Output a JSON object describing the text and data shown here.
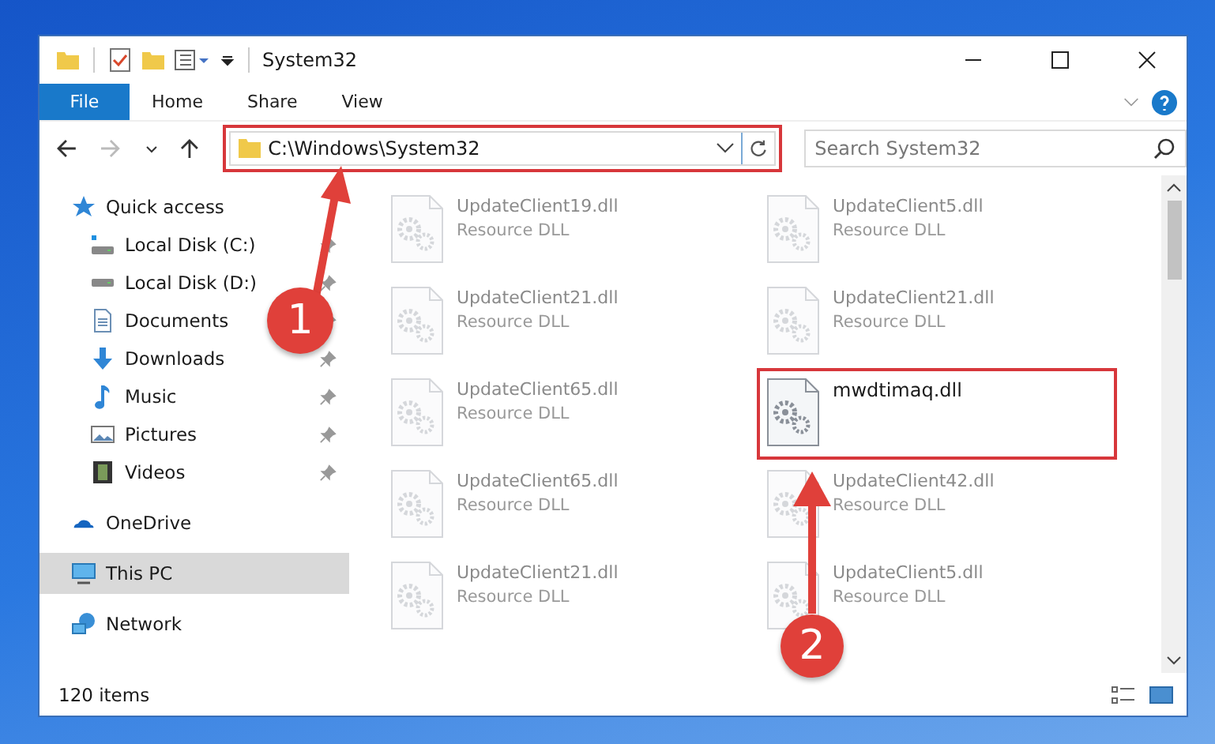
{
  "window": {
    "title": "System32"
  },
  "ribbon_tabs": [
    {
      "label": "File",
      "kind": "file"
    },
    {
      "label": "Home",
      "kind": "tab"
    },
    {
      "label": "Share",
      "kind": "tab"
    },
    {
      "label": "View",
      "kind": "tab"
    }
  ],
  "address": {
    "path": "C:\\Windows\\System32",
    "annotated": true
  },
  "search": {
    "placeholder": "Search System32"
  },
  "navigation": [
    {
      "label": "Quick access",
      "selected": false,
      "children": [
        {
          "label": "Local Disk (C:)",
          "pinned": true,
          "selected": false
        },
        {
          "label": "Local Disk (D:)",
          "pinned": true,
          "selected": false
        },
        {
          "label": "Documents",
          "pinned": true,
          "selected": false
        },
        {
          "label": "Downloads",
          "pinned": true,
          "selected": false
        },
        {
          "label": "Music",
          "pinned": true,
          "selected": false
        },
        {
          "label": "Pictures",
          "pinned": true,
          "selected": false
        },
        {
          "label": "Videos",
          "pinned": true,
          "selected": false
        }
      ]
    },
    {
      "label": "OneDrive",
      "selected": false
    },
    {
      "label": "This PC",
      "selected": true
    },
    {
      "label": "Network",
      "selected": false
    }
  ],
  "files": [
    {
      "name": "UpdateClient19.dll",
      "type": "Resource DLL",
      "dimmed": true,
      "annotated": false
    },
    {
      "name": "UpdateClient5.dll",
      "type": "Resource DLL",
      "dimmed": true,
      "annotated": false
    },
    {
      "name": "UpdateClient21.dll",
      "type": "Resource DLL",
      "dimmed": true,
      "annotated": false
    },
    {
      "name": "UpdateClient21.dll",
      "type": "Resource DLL",
      "dimmed": true,
      "annotated": false
    },
    {
      "name": "UpdateClient65.dll",
      "type": "Resource DLL",
      "dimmed": true,
      "annotated": false
    },
    {
      "name": "mwdtimaq.dll",
      "dimmed": false,
      "annotated": true
    },
    {
      "name": "UpdateClient65.dll",
      "type": "Resource DLL",
      "dimmed": true,
      "annotated": false
    },
    {
      "name": "UpdateClient42.dll",
      "type": "Resource DLL",
      "dimmed": true,
      "annotated": false
    },
    {
      "name": "UpdateClient21.dll",
      "type": "Resource DLL",
      "dimmed": true,
      "annotated": false
    },
    {
      "name": "UpdateClient5.dll",
      "type": "Resource DLL",
      "dimmed": true,
      "annotated": false
    }
  ],
  "annotations": [
    {
      "label": "1"
    },
    {
      "label": "2"
    }
  ],
  "status_bar": {
    "item_count": "120 items"
  }
}
